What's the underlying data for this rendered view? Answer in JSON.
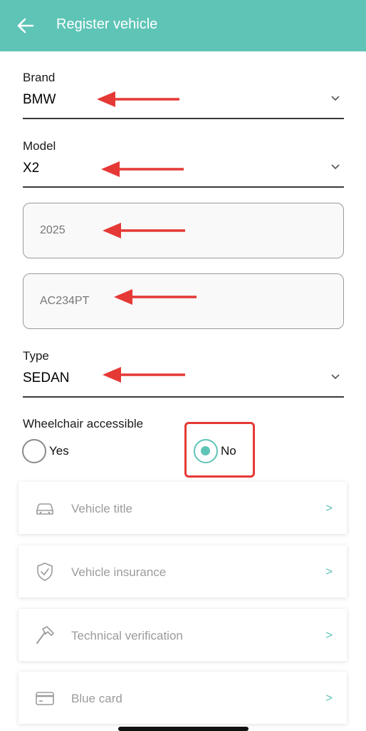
{
  "header": {
    "title": "Register vehicle",
    "back_icon": "arrow-left-icon",
    "background": "#5EC4B6"
  },
  "form": {
    "brand": {
      "label": "Brand",
      "value": "BMW"
    },
    "model": {
      "label": "Model",
      "value": "X2"
    },
    "year": {
      "value": "2025"
    },
    "plate": {
      "value": "AC234PT"
    },
    "type": {
      "label": "Type",
      "value": "SEDAN"
    },
    "wheelchair": {
      "label": "Wheelchair accessible",
      "yes_label": "Yes",
      "no_label": "No",
      "selected": "No"
    }
  },
  "documents": [
    {
      "label": "Vehicle title",
      "icon": "car-icon",
      "chevron": ">"
    },
    {
      "label": "Vehicle insurance",
      "icon": "shield-check-icon",
      "chevron": ">"
    },
    {
      "label": "Technical verification",
      "icon": "hammer-icon",
      "chevron": ">"
    },
    {
      "label": "Blue card",
      "icon": "card-icon",
      "chevron": ">"
    }
  ],
  "colors": {
    "accent": "#5EC4B6",
    "annotation": "#e53935"
  }
}
